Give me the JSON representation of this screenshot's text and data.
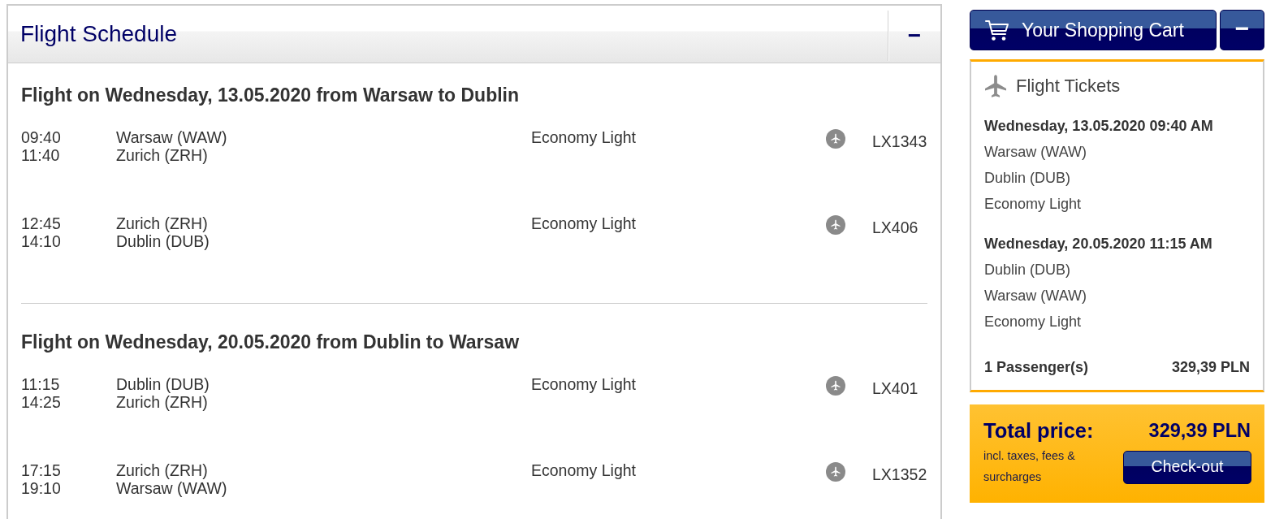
{
  "schedule": {
    "title": "Flight Schedule",
    "collapse_label": "−",
    "journeys": [
      {
        "heading": "Flight on Wednesday, 13.05.2020 from Warsaw to Dublin",
        "segments": [
          {
            "departure_time": "09:40",
            "arrival_time": "11:40",
            "origin": "Warsaw (WAW)",
            "destination": "Zurich (ZRH)",
            "fare_class": "Economy Light",
            "flight_number": "LX1343"
          },
          {
            "departure_time": "12:45",
            "arrival_time": "14:10",
            "origin": "Zurich (ZRH)",
            "destination": "Dublin (DUB)",
            "fare_class": "Economy Light",
            "flight_number": "LX406"
          }
        ]
      },
      {
        "heading": "Flight on Wednesday, 20.05.2020 from Dublin to Warsaw",
        "segments": [
          {
            "departure_time": "11:15",
            "arrival_time": "14:25",
            "origin": "Dublin (DUB)",
            "destination": "Zurich (ZRH)",
            "fare_class": "Economy Light",
            "flight_number": "LX401"
          },
          {
            "departure_time": "17:15",
            "arrival_time": "19:10",
            "origin": "Zurich (ZRH)",
            "destination": "Warsaw (WAW)",
            "fare_class": "Economy Light",
            "flight_number": "LX1352"
          }
        ]
      }
    ]
  },
  "cart": {
    "title": "Your Shopping Cart",
    "collapse_label": "−",
    "tickets": {
      "title": "Flight Tickets",
      "flights": [
        {
          "date_time": "Wednesday, 13.05.2020 09:40 AM",
          "origin": "Warsaw (WAW)",
          "destination": "Dublin (DUB)",
          "fare_class": "Economy Light"
        },
        {
          "date_time": "Wednesday, 20.05.2020 11:15 AM",
          "origin": "Dublin (DUB)",
          "destination": "Warsaw (WAW)",
          "fare_class": "Economy Light"
        }
      ],
      "passengers": "1 Passenger(s)",
      "subtotal": "329,39 PLN"
    },
    "total": {
      "label": "Total price:",
      "amount": "329,39 PLN",
      "note": "incl. taxes, fees & surcharges",
      "checkout_label": "Check-out"
    }
  }
}
